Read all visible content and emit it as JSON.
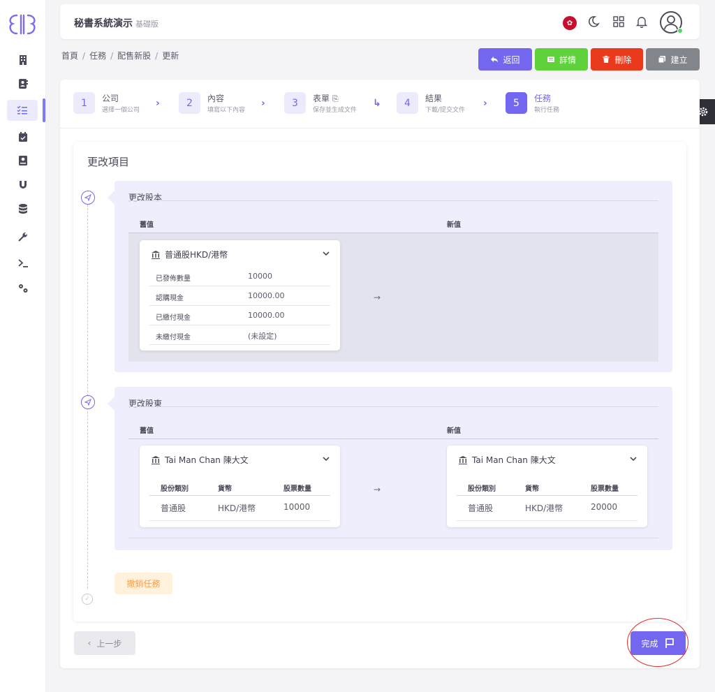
{
  "app": {
    "title": "秘書系統演示",
    "edition": "基礎版"
  },
  "header_icons": [
    "hk-flag-icon",
    "moon-icon",
    "grid-icon",
    "bell-icon",
    "user-icon"
  ],
  "sidebar": {
    "items": [
      "building-icon",
      "contacts-icon",
      "task-list-icon",
      "calendar-icon",
      "book-icon",
      "magnet-icon",
      "database-icon",
      "wrench-icon",
      "terminal-icon",
      "gears-icon"
    ],
    "active_index": 2
  },
  "breadcrumb": [
    "首頁",
    "任務",
    "配售新股",
    "更新"
  ],
  "actions": {
    "back": "返回",
    "detail": "詳情",
    "delete": "刪除",
    "create": "建立"
  },
  "steps": [
    {
      "num": "1",
      "title": "公司",
      "sub": "選擇一個公司"
    },
    {
      "num": "2",
      "title": "內容",
      "sub": "填寫以下內容"
    },
    {
      "num": "3",
      "title": "表單",
      "sub": "保存並生成文件"
    },
    {
      "num": "4",
      "title": "結果",
      "sub": "下載/提交文件"
    },
    {
      "num": "5",
      "title": "任務",
      "sub": "執行任務"
    }
  ],
  "content": {
    "title": "更改項目",
    "old_label": "舊值",
    "new_label": "新值",
    "arrow": "→",
    "share_section": {
      "title": "更改股本",
      "panel_title": "普通股HKD/港幣",
      "rows": [
        {
          "label": "已發佈數量",
          "value": "10000"
        },
        {
          "label": "認購現金",
          "value": "10000.00"
        },
        {
          "label": "已繳付現金",
          "value": "10000.00"
        },
        {
          "label": "未繳付現金",
          "value": "(未設定)"
        }
      ]
    },
    "holder_section": {
      "title": "更改股東",
      "columns": [
        "股份類別",
        "貨幣",
        "股票數量"
      ],
      "old": {
        "name": "Tai Man Chan 陳大文",
        "row": [
          "普通股",
          "HKD/港幣",
          "10000"
        ]
      },
      "new": {
        "name": "Tai Man Chan 陳大文",
        "row": [
          "普通股",
          "HKD/港幣",
          "20000"
        ]
      }
    },
    "revoke": "撤銷任務"
  },
  "footer": {
    "prev": "上一步",
    "finish": "完成"
  },
  "colors": {
    "primary": "#7367f0",
    "success": "#5fd13a",
    "danger": "#ea3a1e",
    "secondary": "#82868b",
    "warning": "#ff9f43"
  }
}
